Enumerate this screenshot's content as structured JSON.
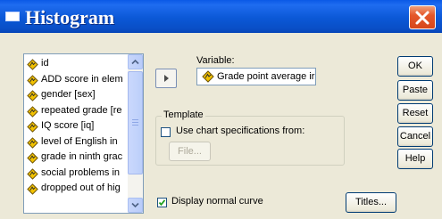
{
  "window": {
    "title": "Histogram"
  },
  "variables": [
    {
      "label": "id"
    },
    {
      "label": "ADD score in elem"
    },
    {
      "label": "gender [sex]"
    },
    {
      "label": "repeated grade [re"
    },
    {
      "label": "IQ score [iq]"
    },
    {
      "label": "level of English in"
    },
    {
      "label": "grade in ninth grac"
    },
    {
      "label": "social problems in"
    },
    {
      "label": "dropped out of hig"
    }
  ],
  "variable_field": {
    "label": "Variable:",
    "value": "Grade point average ir"
  },
  "template": {
    "label": "Template",
    "use_chart_spec_label": "Use chart specifications from:",
    "use_chart_spec_checked": false,
    "file_button": "File..."
  },
  "display_normal_curve": {
    "label": "Display normal curve",
    "checked": true
  },
  "buttons": {
    "ok": "OK",
    "paste": "Paste",
    "reset": "Reset",
    "cancel": "Cancel",
    "help": "Help",
    "titles": "Titles..."
  },
  "colors": {
    "titlebar": "#0a59e6",
    "dialog_bg": "#ece9d8",
    "close": "#e5582b",
    "variable_icon": "#f2c200"
  }
}
